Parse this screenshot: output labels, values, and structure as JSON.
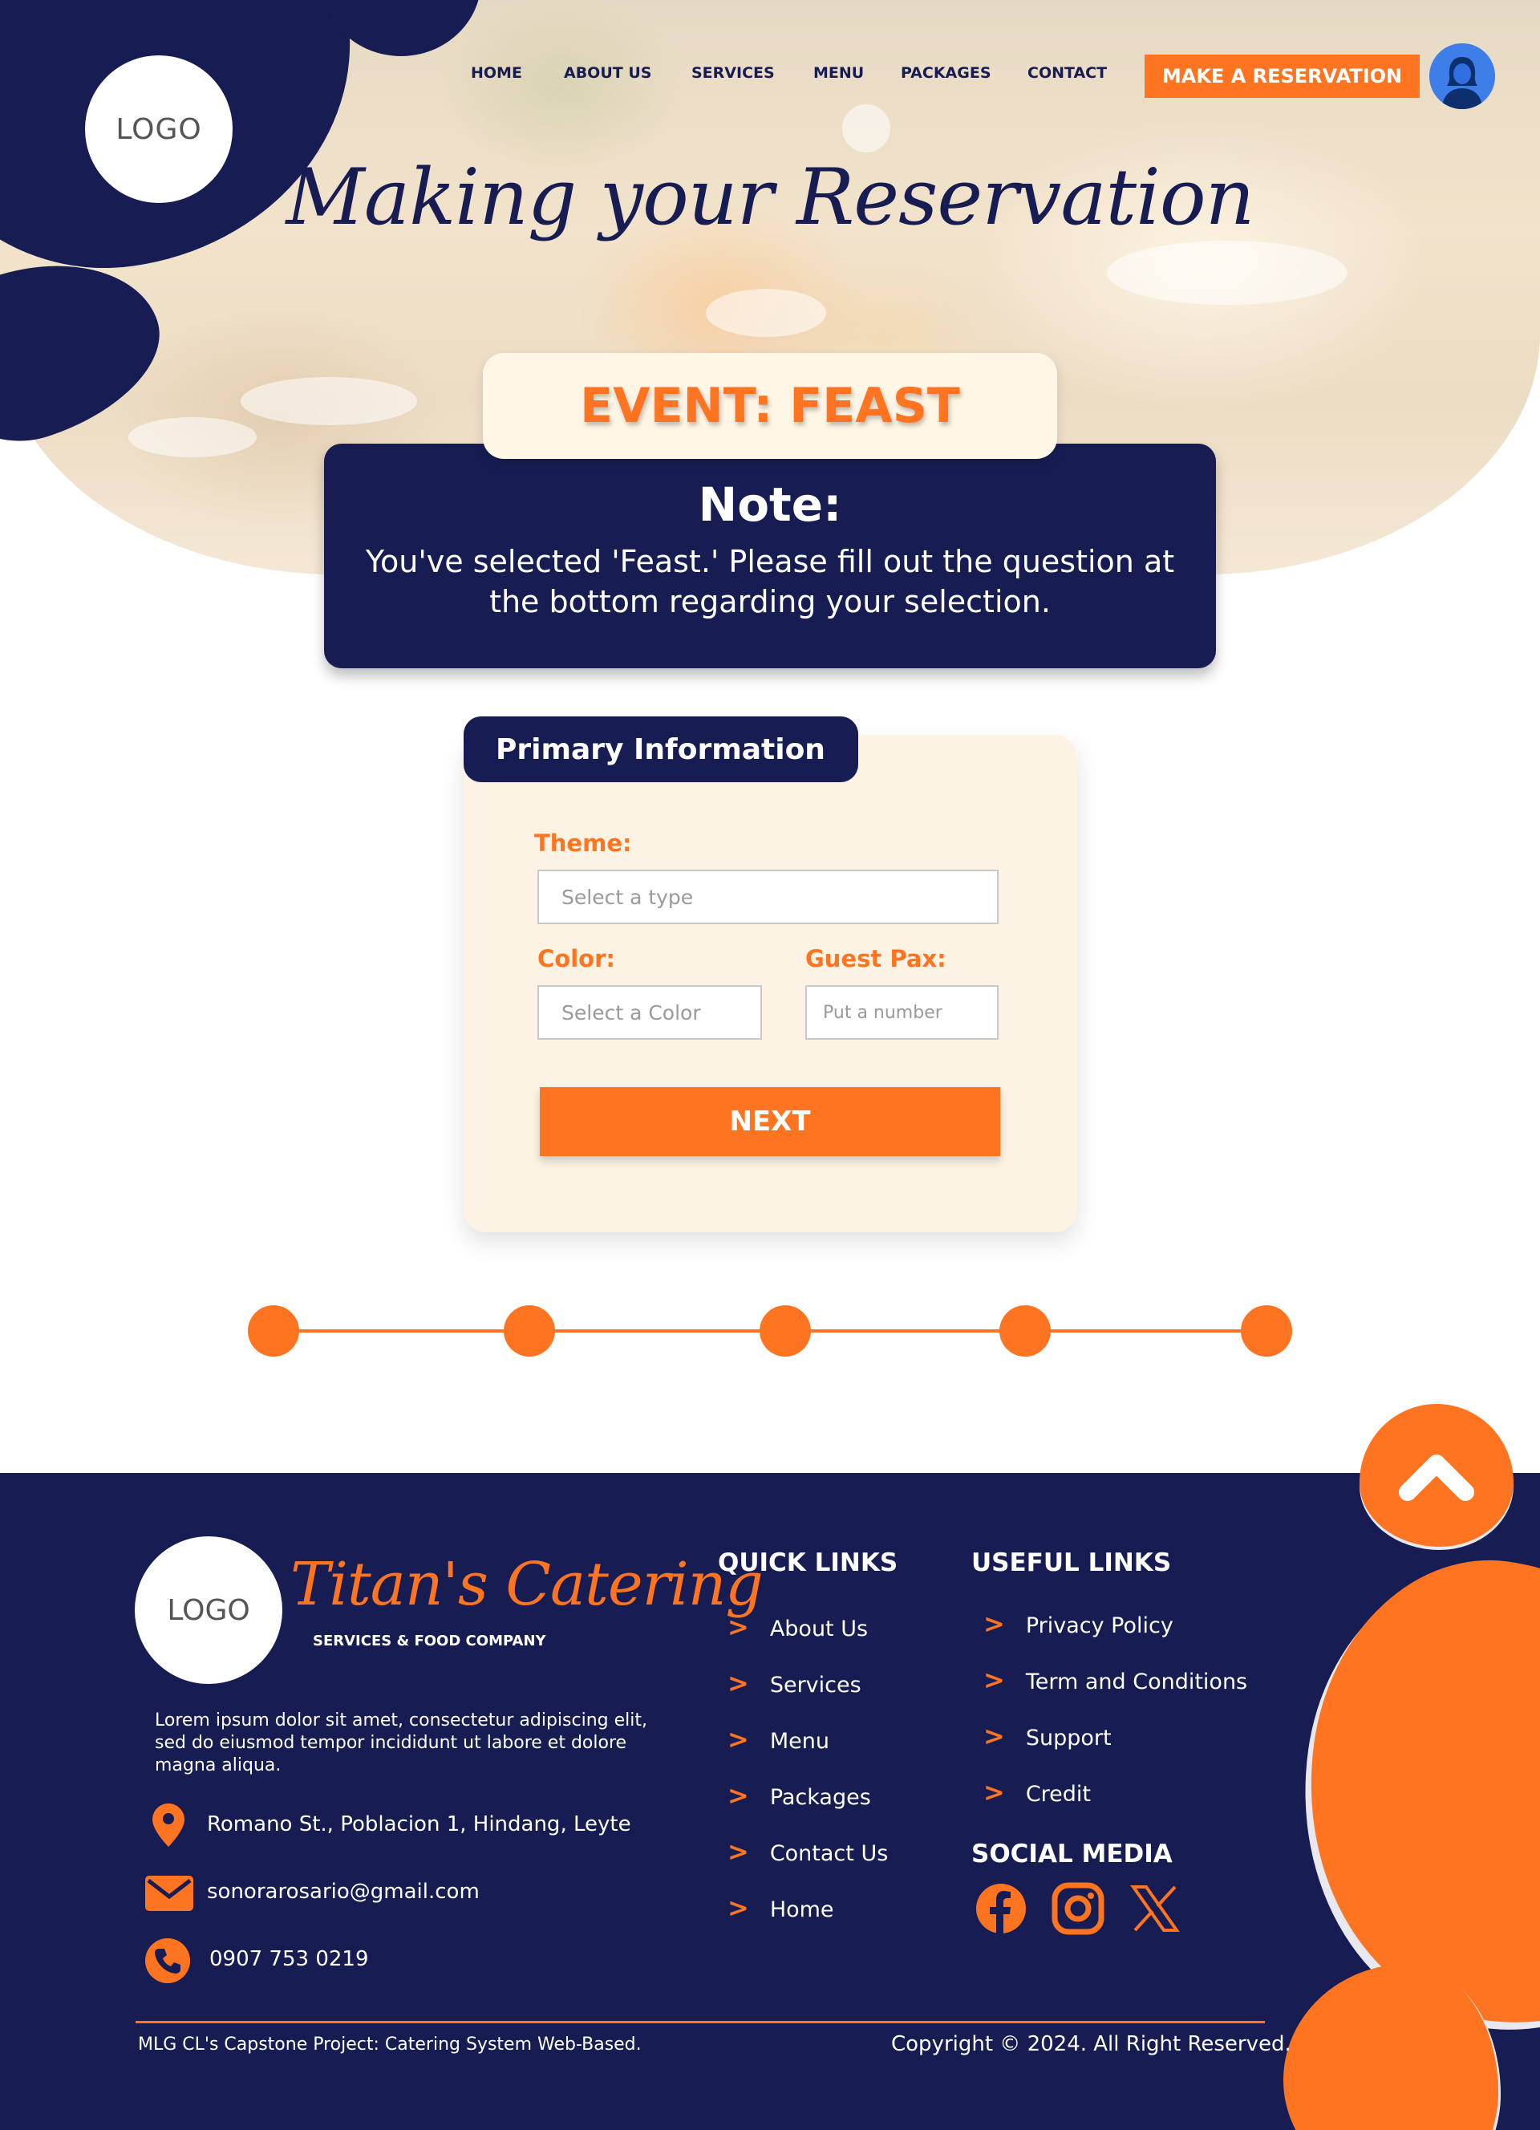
{
  "header": {
    "logo_text": "LOGO",
    "nav": [
      "HOME",
      "ABOUT US",
      "SERVICES",
      "MENU",
      "PACKAGES",
      "CONTACT"
    ],
    "reserve_label": "MAKE A RESERVATION",
    "avatar_icon": "user-avatar-icon"
  },
  "hero": {
    "title": "Making your Reservation"
  },
  "event": {
    "title": "EVENT: FEAST"
  },
  "note": {
    "title": "Note:",
    "text": "You've selected 'Feast.' Please fill out the question at the bottom regarding your selection."
  },
  "form": {
    "tab_title": "Primary Information",
    "theme_label": "Theme:",
    "theme_placeholder": "Select a type",
    "color_label": "Color:",
    "color_placeholder": "Select a Color",
    "pax_label": "Guest Pax:",
    "pax_placeholder": "Put a number",
    "next_label": "NEXT"
  },
  "stepper": {
    "steps": 5,
    "color": "#ff7420"
  },
  "footer": {
    "logo_text": "LOGO",
    "brand_name": "Titan's Catering",
    "brand_tagline": "SERVICES & FOOD COMPANY",
    "description": "Lorem ipsum dolor sit amet, consectetur adipiscing elit, sed do eiusmod tempor incididunt ut labore et dolore magna aliqua.",
    "address": "Romano St., Poblacion 1, Hindang, Leyte",
    "email": "sonorarosario@gmail.com",
    "phone": "0907 753 0219",
    "quick_links_title": "QUICK LINKS",
    "quick_links": [
      "About Us",
      "Services",
      "Menu",
      "Packages",
      "Contact Us",
      "Home"
    ],
    "useful_links_title": "USEFUL LINKS",
    "useful_links": [
      "Privacy Policy",
      "Term and Conditions",
      "Support",
      "Credit"
    ],
    "social_title": "SOCIAL MEDIA",
    "social_icons": [
      "facebook-icon",
      "instagram-icon",
      "x-icon"
    ],
    "credit_left": "MLG CL's Capstone Project: Catering System Web-Based.",
    "credit_right": "Copyright © 2024. All Right Reserved."
  },
  "colors": {
    "navy": "#171d52",
    "orange": "#ff7420",
    "cream": "#fdf3e4"
  }
}
